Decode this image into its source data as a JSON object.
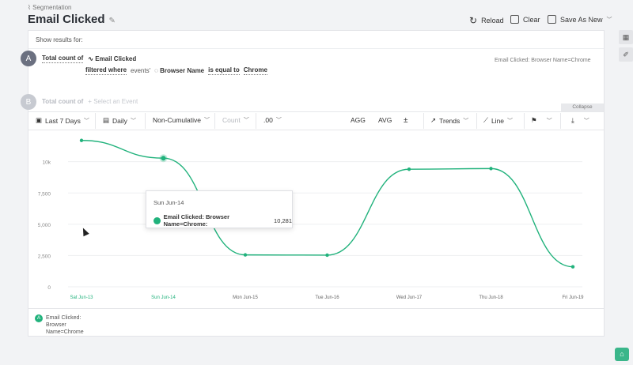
{
  "header": {
    "breadcrumb": "Segmentation",
    "title": "Email Clicked",
    "reload_label": "Reload",
    "clear_label": "Clear",
    "save_label": "Save As New"
  },
  "query": {
    "show_results_label": "Show results for:",
    "a": {
      "letter": "A",
      "measure": "Total count of",
      "event": "Email Clicked",
      "filtered_where": "filtered where",
      "events_label": "events'",
      "property": "Browser Name",
      "operator": "is equal to",
      "value": "Chrome",
      "summary": "Email Clicked: Browser Name=Chrome"
    },
    "b": {
      "letter": "B",
      "measure": "Total count of",
      "placeholder": "Select an Event"
    },
    "collapse_label": "Collapse"
  },
  "toolbar": {
    "range": "Last 7 Days",
    "interval": "Daily",
    "cumulative": "Non-Cumulative",
    "count": "Count",
    "decimals": ".00",
    "agg": "AGG",
    "avg": "AVG",
    "trends": "Trends",
    "chart_type": "Line"
  },
  "tooltip": {
    "date": "Sun Jun-14",
    "series_label": "Email Clicked: Browser Name=Chrome:",
    "value": "10,281"
  },
  "legend": {
    "letter": "A",
    "label": "Email Clicked: Browser Name=Chrome"
  },
  "colors": {
    "accent": "#21b27c"
  },
  "chart_data": {
    "type": "line",
    "categories": [
      "Sat Jun-13",
      "Sun Jun-14",
      "Mon Jun-15",
      "Tue Jun-16",
      "Wed Jun-17",
      "Thu Jun-18",
      "Fri Jun-19"
    ],
    "series": [
      {
        "name": "Email Clicked: Browser Name=Chrome",
        "values": [
          11700,
          10281,
          2550,
          2530,
          9400,
          9450,
          1600
        ]
      }
    ],
    "yticks": [
      "0",
      "2,500",
      "5,000",
      "7,500",
      "10k"
    ],
    "ylim": [
      0,
      12000
    ],
    "highlighted_index": 1,
    "grid": true
  }
}
